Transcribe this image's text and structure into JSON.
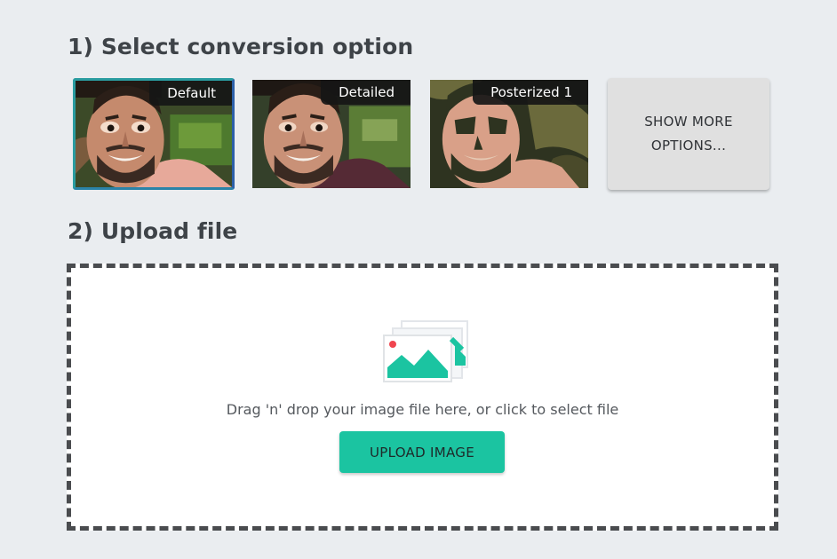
{
  "step1": {
    "title": "1) Select conversion option",
    "options": [
      {
        "label": "Default",
        "selected": true
      },
      {
        "label": "Detailed",
        "selected": false
      },
      {
        "label": "Posterized 1",
        "selected": false
      }
    ],
    "more_label": "SHOW MORE OPTIONS..."
  },
  "step2": {
    "title": "2) Upload file",
    "drop_icon": "images-stack-icon",
    "drop_text": "Drag 'n' drop your image file here, or click to select file",
    "upload_label": "UPLOAD IMAGE"
  },
  "colors": {
    "page_background": "#eaedf0",
    "accent": "#1bc4a1",
    "selected_border": "#2a9ca0",
    "dropzone_border": "#4a4c4f"
  }
}
